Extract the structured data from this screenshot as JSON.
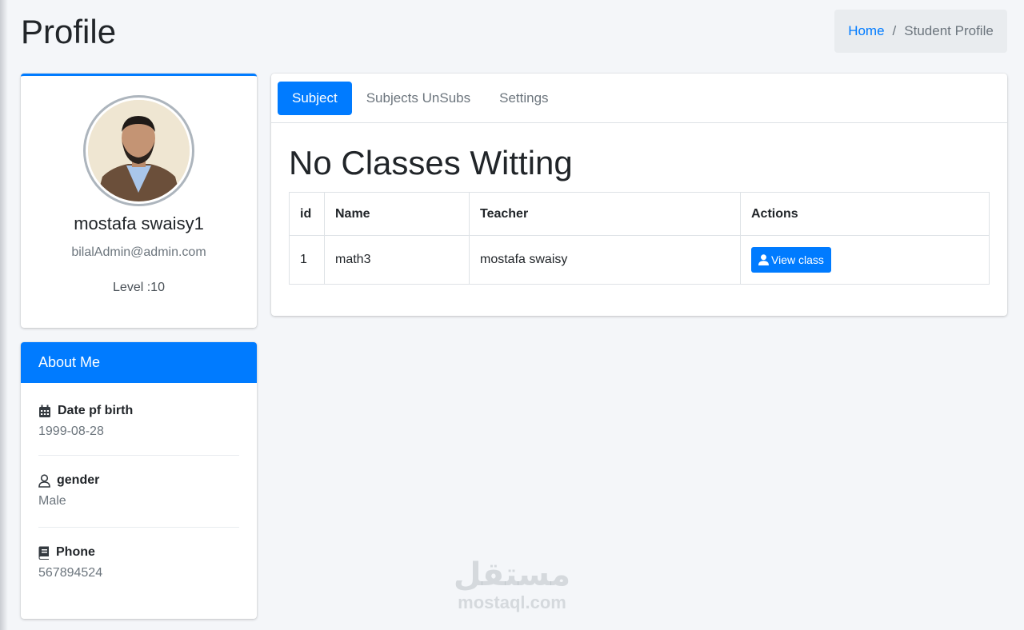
{
  "page": {
    "title": "Profile"
  },
  "breadcrumb": {
    "home": "Home",
    "separator": "/",
    "current": "Student Profile"
  },
  "profile": {
    "name": "mostafa swaisy1",
    "email": "bilalAdmin@admin.com",
    "level": "Level :10"
  },
  "about": {
    "title": "About Me",
    "items": [
      {
        "icon": "calendar-icon",
        "label": "Date pf birth",
        "value": "1999-08-28"
      },
      {
        "icon": "user-icon",
        "label": "gender",
        "value": "Male"
      },
      {
        "icon": "book-icon",
        "label": "Phone",
        "value": "567894524"
      }
    ]
  },
  "tabs": [
    {
      "label": "Subject",
      "active": true
    },
    {
      "label": "Subjects UnSubs",
      "active": false
    },
    {
      "label": "Settings",
      "active": false
    }
  ],
  "main": {
    "heading": "No Classes Witting",
    "table": {
      "headers": [
        "id",
        "Name",
        "Teacher",
        "Actions"
      ],
      "rows": [
        {
          "id": "1",
          "name": "math3",
          "teacher": "mostafa swaisy",
          "action": "View class"
        }
      ]
    }
  },
  "watermark": {
    "arabic": "مستقل",
    "latin": "mostaql.com"
  },
  "colors": {
    "primary": "#007bff",
    "background": "#f4f6f9"
  }
}
